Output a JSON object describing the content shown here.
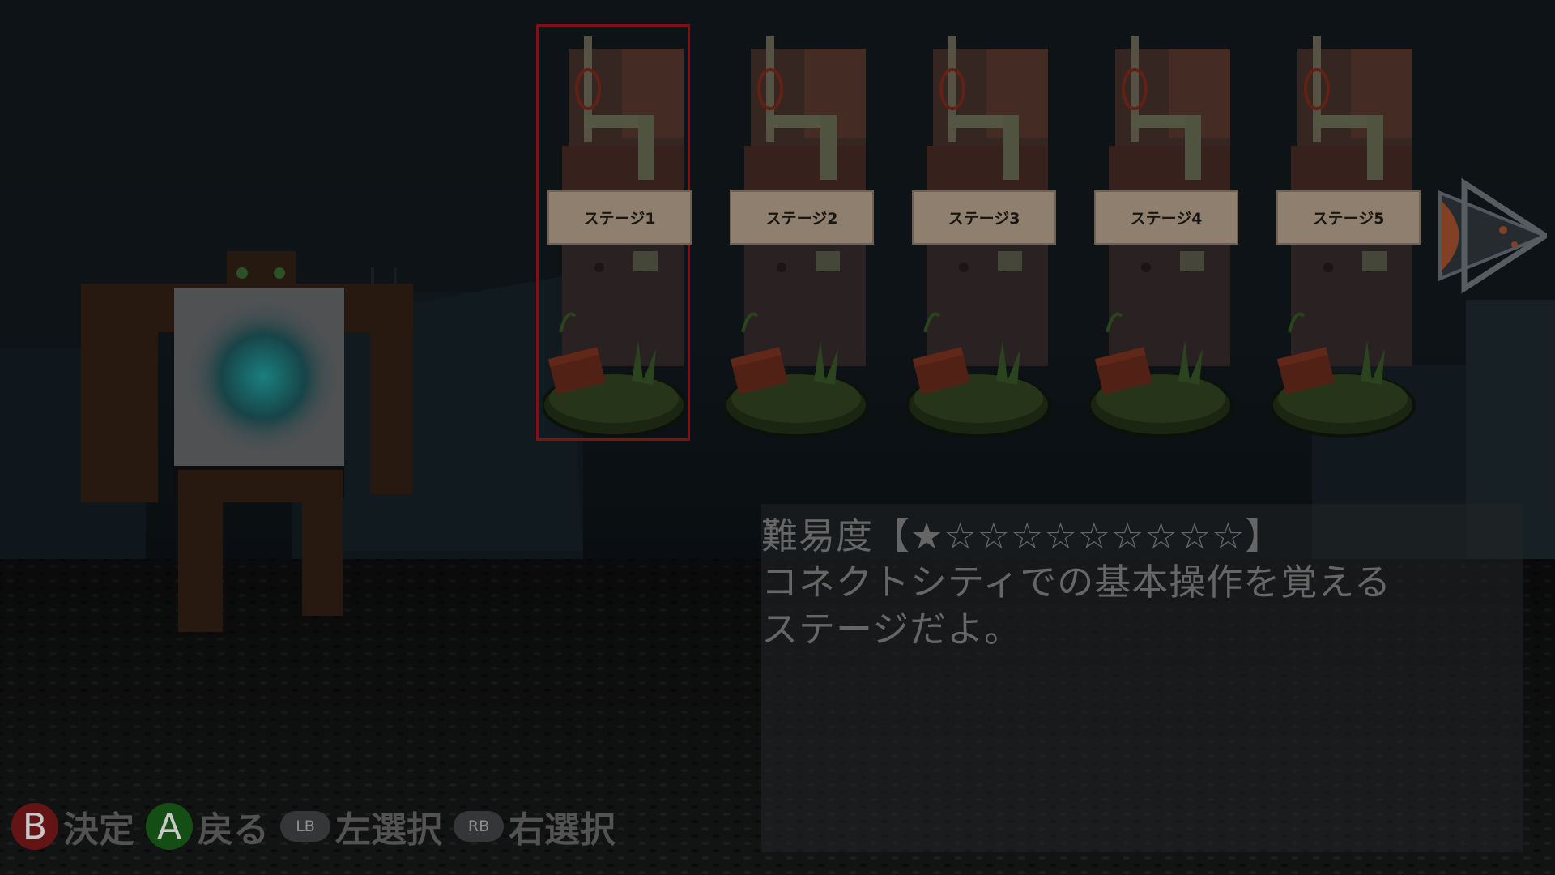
{
  "stages": [
    {
      "label": "ステージ1",
      "selected": true
    },
    {
      "label": "ステージ2",
      "selected": false
    },
    {
      "label": "ステージ3",
      "selected": false
    },
    {
      "label": "ステージ4",
      "selected": false
    },
    {
      "label": "ステージ5",
      "selected": false
    }
  ],
  "description": {
    "difficulty": "難易度【★☆☆☆☆☆☆☆☆☆】",
    "line1": "コネクトシティでの基本操作を覚える",
    "line2": "ステージだよ。"
  },
  "footer": {
    "b_button": "B",
    "b_label": "決定",
    "a_button": "A",
    "a_label": "戻る",
    "lb_button": "LB",
    "lb_label": "左選択",
    "rb_button": "RB",
    "rb_label": "右選択"
  },
  "colors": {
    "selection_frame": "#8c1313",
    "label_plate": "#9b8a78",
    "b_button": "#6d1616",
    "a_button": "#175517",
    "arrow": "#9b4a2c"
  }
}
